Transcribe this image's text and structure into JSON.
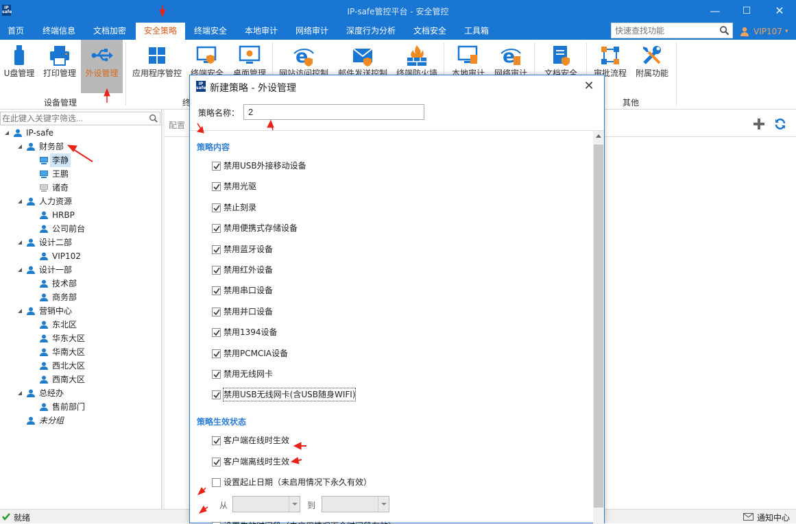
{
  "app": {
    "title": "IP-safe管控平台 - 安全管控",
    "logo_text": "IP safe"
  },
  "menu": [
    {
      "label": "首页"
    },
    {
      "label": "终端信息"
    },
    {
      "label": "文档加密"
    },
    {
      "label": "安全策略",
      "active": true
    },
    {
      "label": "终端安全"
    },
    {
      "label": "本地审计"
    },
    {
      "label": "网络审计"
    },
    {
      "label": "深度行为分析"
    },
    {
      "label": "文档安全"
    },
    {
      "label": "工具箱"
    }
  ],
  "search": {
    "placeholder": "快速查找功能"
  },
  "user": {
    "name": "VIP107"
  },
  "ribbon": {
    "buttons": [
      "U盘管理",
      "打印管理",
      "外设管理",
      "应用程序管控",
      "终端安全",
      "桌面管理",
      "网站访问控制",
      "邮件发送控制",
      "终端防火墙",
      "本地审计",
      "网络审计",
      "文档安全",
      "审批流程",
      "附属功能"
    ],
    "groups": [
      "设备管理",
      "终",
      "其他"
    ]
  },
  "tree": {
    "filter_placeholder": "在此键入关键字筛选...",
    "nodes": [
      "IP-safe",
      "财务部",
      "李静",
      "王鹏",
      "诸奇",
      "人力资源",
      "HRBP",
      "公司前台",
      "设计二部",
      "VIP102",
      "设计一部",
      "技术部",
      "商务部",
      "营销中心",
      "东北区",
      "华东大区",
      "华南大区",
      "西北大区",
      "西南大区",
      "总经办",
      "售前部门",
      "未分组"
    ]
  },
  "content": {
    "config_label": "配置"
  },
  "status": {
    "ready": "就绪",
    "notify": "通知中心"
  },
  "dialog": {
    "title": "新建策略 - 外设管理",
    "name_label": "策略名称：",
    "name_value": "2",
    "section_content": "策略内容",
    "items": [
      {
        "label": "禁用USB外接移动设备",
        "checked": true
      },
      {
        "label": "禁用光驱",
        "checked": true
      },
      {
        "label": "禁止刻录",
        "checked": true
      },
      {
        "label": "禁用便携式存储设备",
        "checked": true
      },
      {
        "label": "禁用蓝牙设备",
        "checked": true
      },
      {
        "label": "禁用红外设备",
        "checked": true
      },
      {
        "label": "禁用串口设备",
        "checked": true
      },
      {
        "label": "禁用并口设备",
        "checked": true
      },
      {
        "label": "禁用1394设备",
        "checked": true
      },
      {
        "label": "禁用PCMCIA设备",
        "checked": true
      },
      {
        "label": "禁用无线网卡",
        "checked": true
      },
      {
        "label": "禁用USB无线网卡(含USB随身WIFI)",
        "checked": true
      }
    ],
    "section_status": "策略生效状态",
    "status_items": [
      {
        "label": "客户端在线时生效",
        "checked": true
      },
      {
        "label": "客户端离线时生效",
        "checked": true
      },
      {
        "label": "设置起止日期（未启用情况下永久有效）",
        "checked": false
      }
    ],
    "from_label": "从",
    "to_label": "到",
    "last_item": "设置生效时间段（未启用情况下全时间段有效）"
  },
  "colors": {
    "brand": "#1976d2",
    "accent": "#d95b1e",
    "annotation": "#e8231a"
  }
}
